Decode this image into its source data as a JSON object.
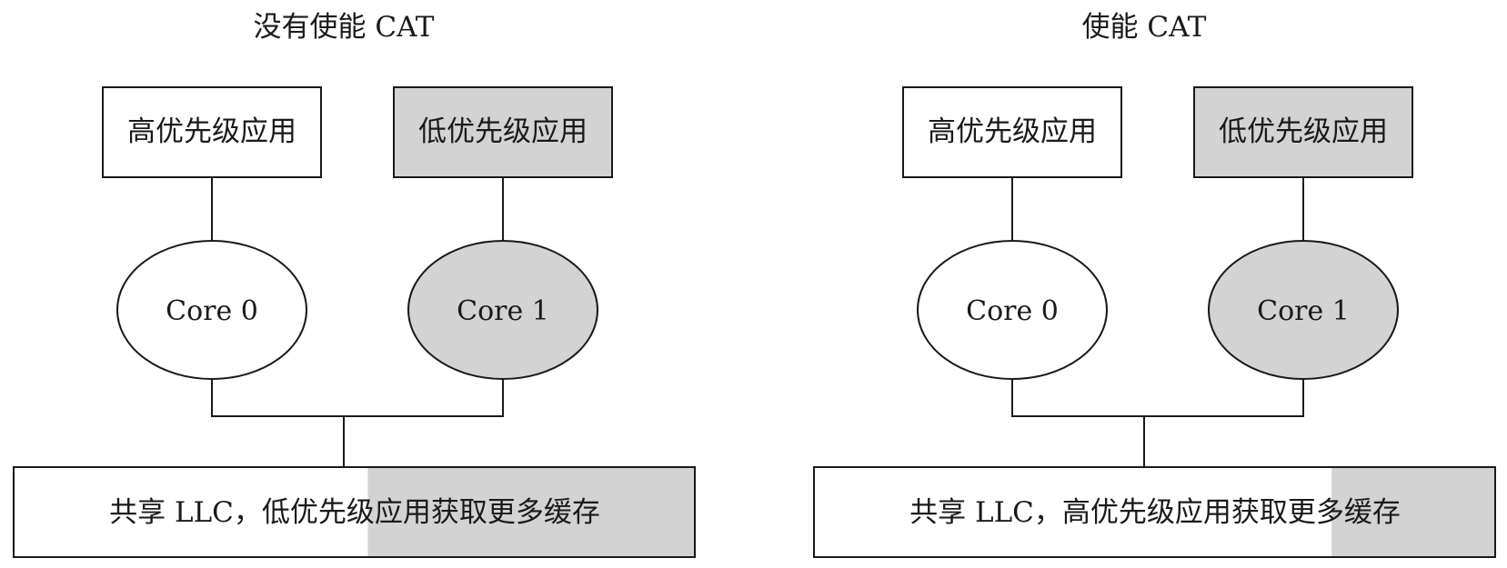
{
  "colors": {
    "white_fill": "#ffffff",
    "gray_fill": "#d3d3d3",
    "stroke": "#1a1a1a"
  },
  "diagrams": [
    {
      "title": "没有使能 CAT",
      "high_app_label": "高优先级应用",
      "low_app_label": "低优先级应用",
      "core0_label": "Core 0",
      "core1_label": "Core 1",
      "llc_label": "共享 LLC，低优先级应用获取更多缓存",
      "low_priority_cache_share": 0.48
    },
    {
      "title": "使能 CAT",
      "high_app_label": "高优先级应用",
      "low_app_label": "低优先级应用",
      "core0_label": "Core 0",
      "core1_label": "Core 1",
      "llc_label": "共享 LLC，高优先级应用获取更多缓存",
      "low_priority_cache_share": 0.24
    }
  ]
}
